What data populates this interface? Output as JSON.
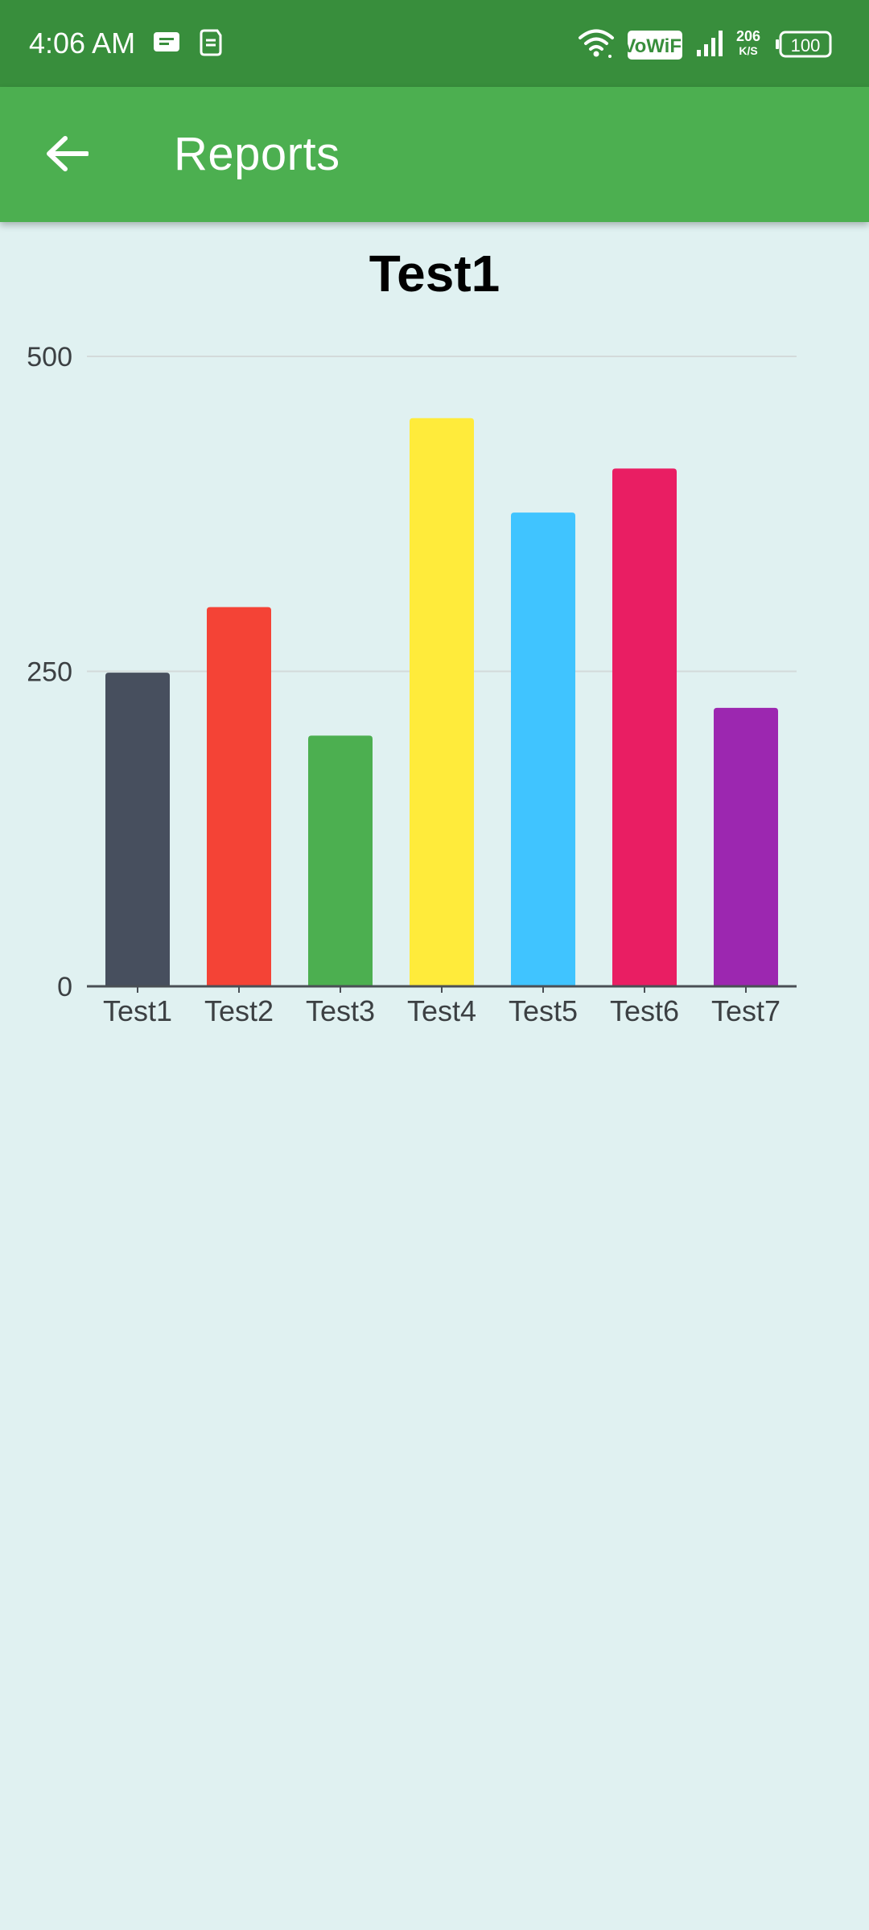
{
  "status_bar": {
    "time": "4:06 AM",
    "vowifi": "VoWiFi",
    "net_speed_value": "206",
    "net_speed_unit": "K/S",
    "battery": "100",
    "icons": [
      "message-icon",
      "sim-icon",
      "wifi-icon",
      "vowifi-icon",
      "signal-icon",
      "battery-icon"
    ]
  },
  "app_bar": {
    "title": "Reports",
    "back_icon": "arrow-left-icon",
    "color": "#4caf50"
  },
  "chart_data": {
    "type": "bar",
    "title": "Test1",
    "categories": [
      "Test1",
      "Test2",
      "Test3",
      "Test4",
      "Test5",
      "Test6",
      "Test7"
    ],
    "values": [
      249,
      301,
      199,
      451,
      376,
      411,
      221
    ],
    "colors": [
      "#474f5e",
      "#f44336",
      "#4caf50",
      "#ffeb3b",
      "#40c4ff",
      "#e91e63",
      "#9c27b0"
    ],
    "ylim": [
      0,
      500
    ],
    "yticks": [
      0,
      250,
      500
    ],
    "grid": true
  }
}
